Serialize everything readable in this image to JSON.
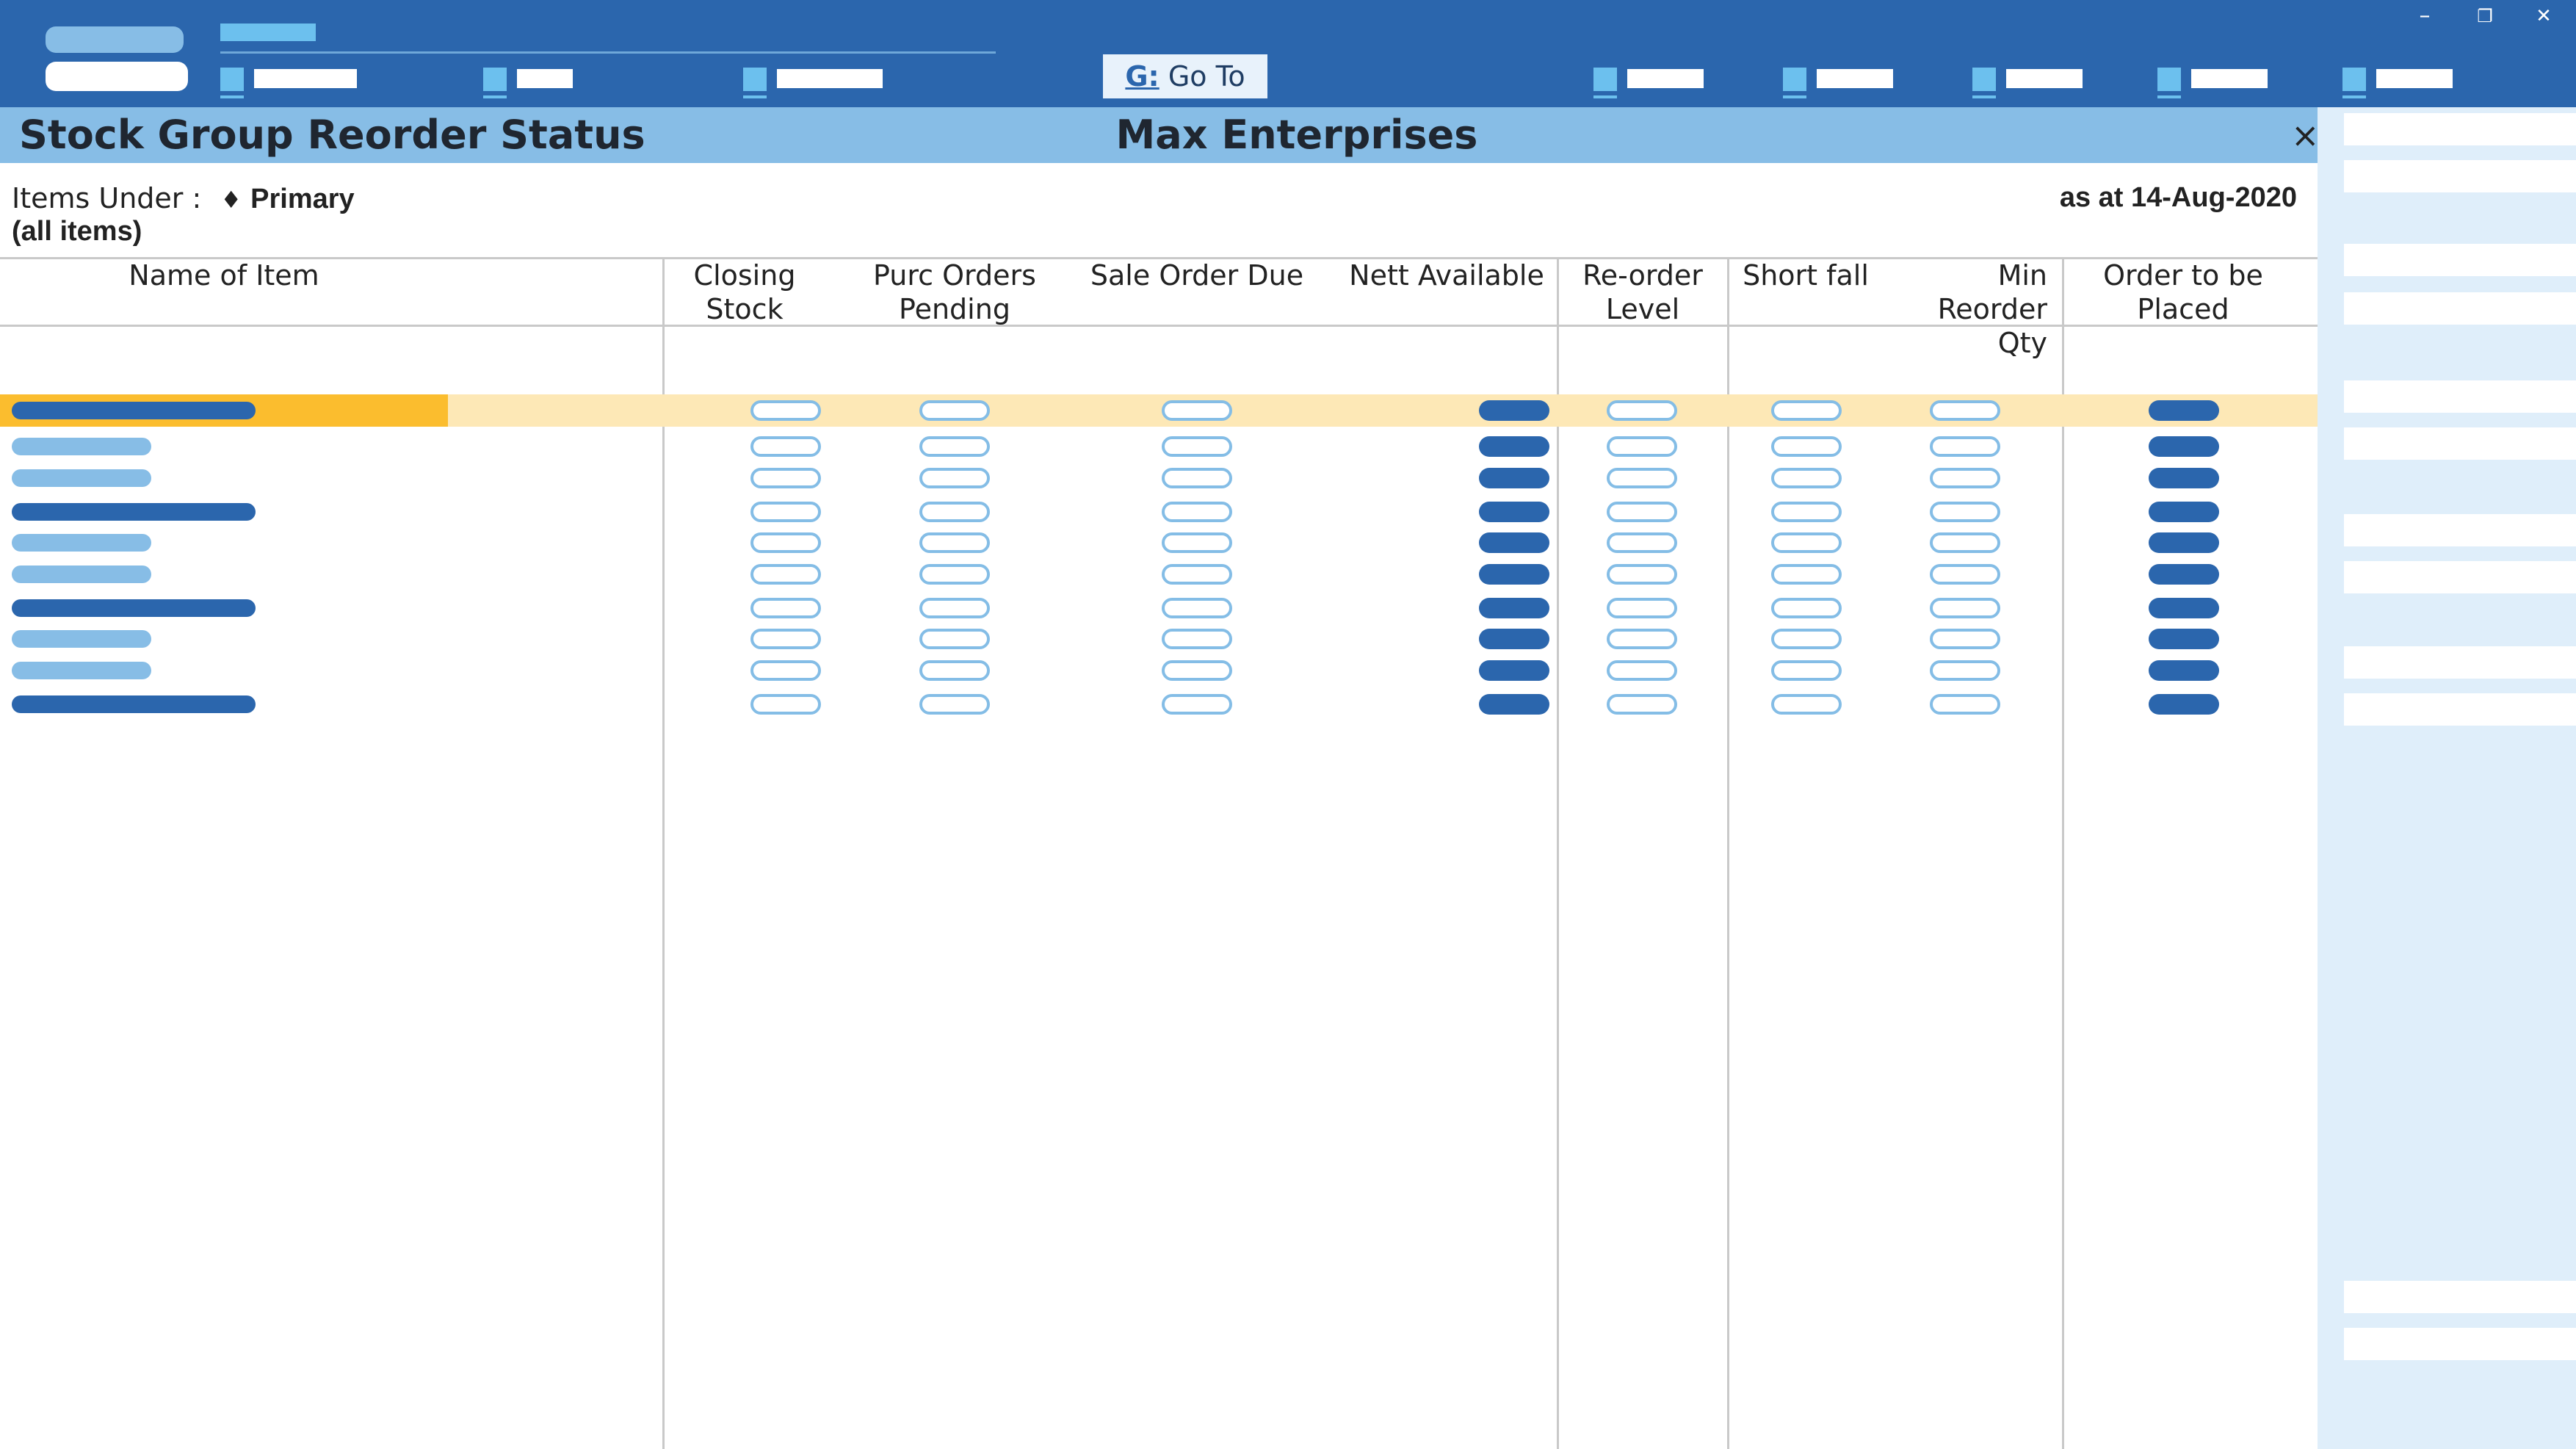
{
  "toolbar": {
    "goto_key": "G:",
    "goto_label": "Go To"
  },
  "window_controls": {
    "minimize": "–",
    "restore": "❐",
    "close": "✕"
  },
  "header": {
    "report_title": "Stock Group Reorder Status",
    "company": "Max Enterprises",
    "close_icon": "×"
  },
  "info": {
    "items_under_label": "Items Under :",
    "group_marker": "♦",
    "group_name": "Primary",
    "subtitle": "(all items)",
    "as_at": "as at 14-Aug-2020"
  },
  "table": {
    "columns": [
      "Name of Item",
      "Closing\nStock",
      "Purc Orders\nPending",
      "Sale Order Due",
      "Nett Available",
      "Re-order\nLevel",
      "Short fall",
      "Min Reorder\nQty",
      "Order to be\nPlaced"
    ],
    "rows": [
      {
        "kind": "long",
        "selected": true
      },
      {
        "kind": "short"
      },
      {
        "kind": "short"
      },
      {
        "kind": "long"
      },
      {
        "kind": "short"
      },
      {
        "kind": "short"
      },
      {
        "kind": "long"
      },
      {
        "kind": "short"
      },
      {
        "kind": "short"
      },
      {
        "kind": "long"
      }
    ]
  },
  "colors": {
    "bar": "#2b66ad",
    "title_band": "#87bde6",
    "selected_row": "#fde8b6",
    "selected_name": "#fbbd2e",
    "right_panel": "#dfeefa"
  }
}
